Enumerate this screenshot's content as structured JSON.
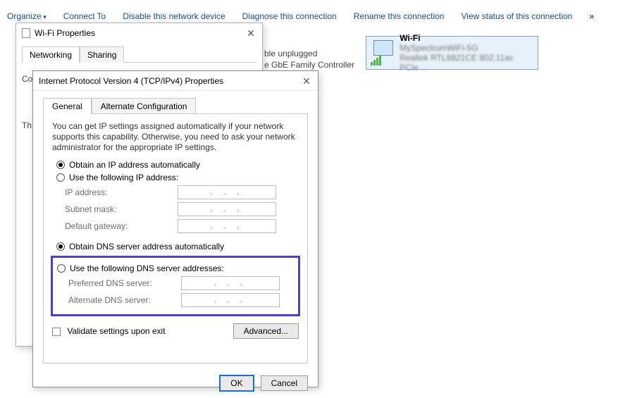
{
  "toolbar": {
    "organize": "Organize",
    "connect": "Connect To",
    "disable": "Disable this network device",
    "diagnose": "Diagnose this connection",
    "rename": "Rename this connection",
    "viewstatus": "View status of this connection",
    "more": "»"
  },
  "status_peek": {
    "line1": "ble unplugged",
    "line2": "e GbE Family Controller"
  },
  "wifi_tile": {
    "title": "Wi-Fi",
    "ssid": "MySpectrumWiFi-5G",
    "adapter": "Realtek RTL8821CE 802.11ac PCIe ..."
  },
  "win1": {
    "title": "Wi-Fi Properties",
    "tabs": {
      "networking": "Networking",
      "sharing": "Sharing"
    },
    "connect_using": "Connect using:",
    "th_label": "Th"
  },
  "win2": {
    "title": "Internet Protocol Version 4 (TCP/IPv4) Properties",
    "tabs": {
      "general": "General",
      "alt": "Alternate Configuration"
    },
    "help": "You can get IP settings assigned automatically if your network supports this capability. Otherwise, you need to ask your network administrator for the appropriate IP settings.",
    "ip_auto": "Obtain an IP address automatically",
    "ip_manual": "Use the following IP address:",
    "ip_addr": "IP address:",
    "subnet": "Subnet mask:",
    "gateway": "Default gateway:",
    "dns_auto": "Obtain DNS server address automatically",
    "dns_manual": "Use the following DNS server addresses:",
    "pref_dns": "Preferred DNS server:",
    "alt_dns": "Alternate DNS server:",
    "validate": "Validate settings upon exit",
    "advanced": "Advanced...",
    "ok": "OK",
    "cancel": "Cancel",
    "ip_placeholder": ".   .   ."
  }
}
